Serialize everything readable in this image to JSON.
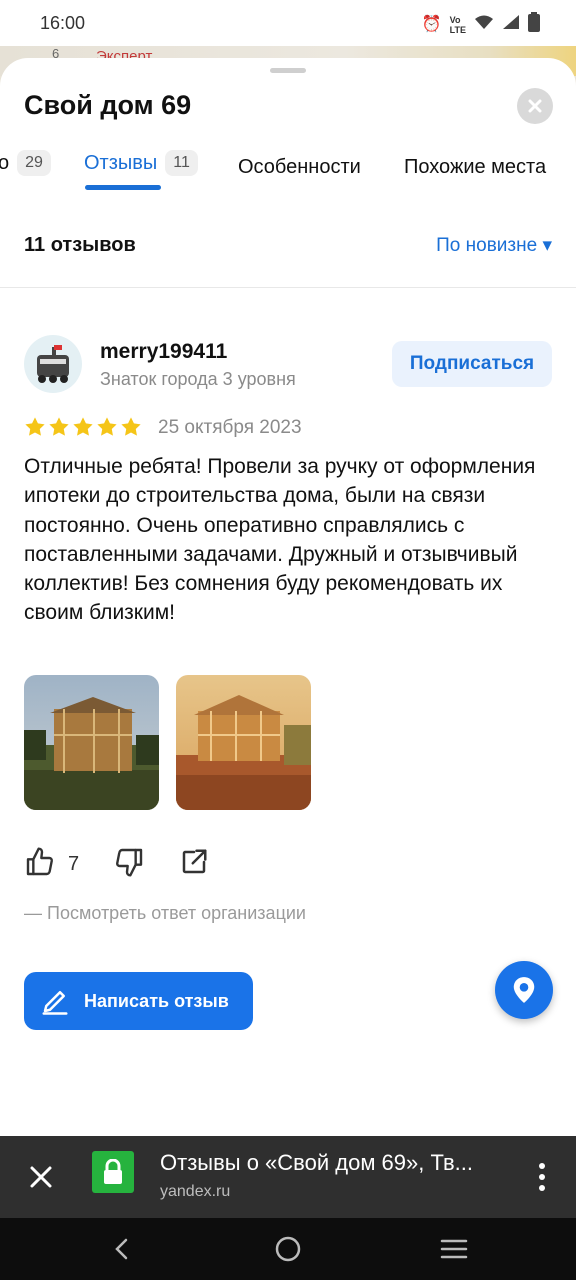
{
  "status_bar": {
    "time": "16:00"
  },
  "map": {
    "label": "Эксперт",
    "num": "6"
  },
  "place": {
    "title": "Свой дом 69"
  },
  "tabs": [
    {
      "label": "о",
      "count": "29"
    },
    {
      "label": "Отзывы",
      "count": "11"
    },
    {
      "label": "Особенности"
    },
    {
      "label": "Похожие места"
    }
  ],
  "reviews": {
    "summary": "11 отзывов",
    "sort_label": "По новизне ▾"
  },
  "review": {
    "username": "merry199411",
    "level": "Знаток города 3 уровня",
    "subscribe_label": "Подписаться",
    "rating": 5,
    "date": "25 октября 2023",
    "text": "Отличные ребята! Провели за ручку от оформления ипотеки до строительства дома, были на связи постоянно. Очень оперативно справлялись с поставленными задачами. Дружный и отзывчивый коллектив! Без сомнения буду рекомендовать их своим близким!",
    "likes": "7",
    "org_answer": "—  Посмотреть ответ организации"
  },
  "write_review_label": "Написать отзыв",
  "custom_tab": {
    "title": "Отзывы о «Свой дом 69», Тв...",
    "url": "yandex.ru"
  },
  "icons": {
    "close": "close-icon",
    "like": "thumbs-up-icon",
    "dislike": "thumbs-down-icon",
    "share": "share-icon",
    "pencil": "pencil-icon",
    "location": "location-pin-icon",
    "lock": "lock-icon",
    "menu": "more-vert-icon"
  },
  "colors": {
    "accent": "#1a6fd6",
    "button": "#1a73e8",
    "star": "#f5c518",
    "lock_bg": "#26b33e"
  }
}
